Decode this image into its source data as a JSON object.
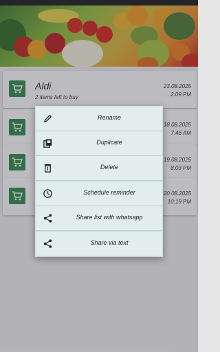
{
  "lists": [
    {
      "name": "Aldi",
      "subtitle": "2 items left to buy",
      "date": "23.08.2025",
      "time": "2:09 PM"
    },
    {
      "name": "",
      "subtitle": "",
      "date": "18.08.2025",
      "time": "7:46 AM"
    },
    {
      "name": "",
      "subtitle": "",
      "date": "19.08.2025",
      "time": "8:03 PM"
    },
    {
      "name": "",
      "subtitle": "",
      "date": "20.08.2025",
      "time": "10:19 PM"
    }
  ],
  "menu": {
    "rename": "Rename",
    "duplicate": "Duplicate",
    "delete": "Delete",
    "schedule": "Schedule reminder",
    "share_whatsapp": "Share list with whatsapp",
    "share_text": "Share via text"
  },
  "colors": {
    "accent": "#2e8b4a",
    "menu_background": "#e2eeeb"
  },
  "icons": {
    "list": "shopping-cart-icon"
  }
}
